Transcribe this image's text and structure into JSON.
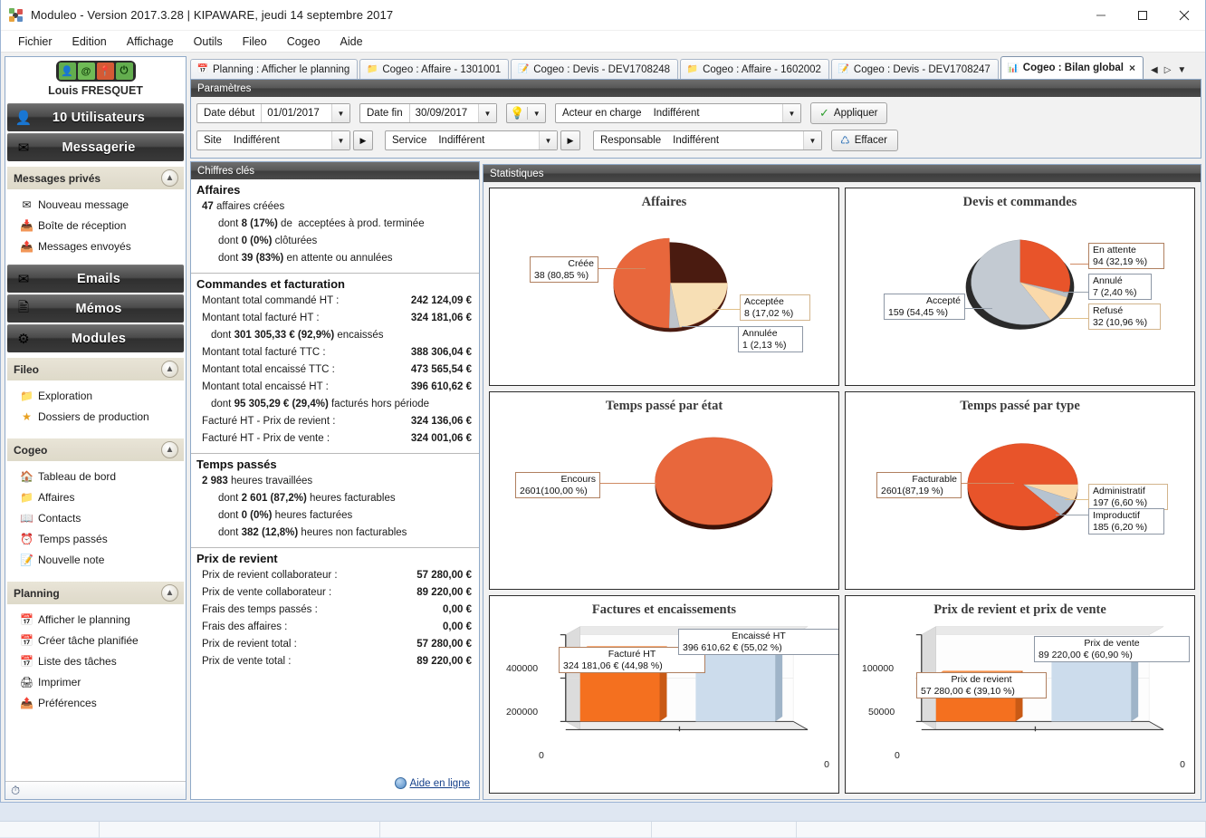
{
  "window": {
    "title": "Moduleo - Version 2017.3.28 | KIPAWARE, jeudi 14 septembre 2017",
    "minimize_label": "–",
    "maximize_label": "□",
    "close_label": "✕"
  },
  "menubar": {
    "items": [
      {
        "label": "Fichier"
      },
      {
        "label": "Edition"
      },
      {
        "label": "Affichage"
      },
      {
        "label": "Outils"
      },
      {
        "label": "Fileo"
      },
      {
        "label": "Cogeo"
      },
      {
        "label": "Aide"
      }
    ]
  },
  "sidebar": {
    "user_name": "Louis FRESQUET",
    "user_icons": [
      "contact-icon",
      "at-icon",
      "map-icon",
      "power-icon"
    ],
    "bands": [
      {
        "label": "10 Utilisateurs",
        "icon": "user-icon"
      },
      {
        "label": "Messagerie",
        "icon": "envelope-icon"
      },
      {
        "label": "Emails",
        "icon": "at-icon"
      },
      {
        "label": "Mémos",
        "icon": "note-icon"
      },
      {
        "label": "Modules",
        "icon": "modules-icon"
      }
    ],
    "groups": [
      {
        "title": "Messages privés",
        "items": [
          {
            "label": "Nouveau message",
            "icon": "new-message-icon"
          },
          {
            "label": "Boîte de réception",
            "icon": "inbox-icon"
          },
          {
            "label": "Messages envoyés",
            "icon": "sent-icon"
          }
        ]
      },
      {
        "title": "Fileo",
        "items": [
          {
            "label": "Exploration",
            "icon": "folder-search-icon"
          },
          {
            "label": "Dossiers de production",
            "icon": "star-icon"
          }
        ]
      },
      {
        "title": "Cogeo",
        "items": [
          {
            "label": "Tableau de bord",
            "icon": "home-icon"
          },
          {
            "label": "Affaires",
            "icon": "folder-icon"
          },
          {
            "label": "Contacts",
            "icon": "contacts-book-icon"
          },
          {
            "label": "Temps passés",
            "icon": "clock-icon"
          },
          {
            "label": "Nouvelle note",
            "icon": "new-note-icon"
          }
        ]
      },
      {
        "title": "Planning",
        "items": [
          {
            "label": "Afficher le planning",
            "icon": "calendar-icon"
          },
          {
            "label": "Créer tâche planifiée",
            "icon": "calendar-add-icon"
          },
          {
            "label": "Liste des tâches",
            "icon": "calendar-list-icon"
          },
          {
            "label": "Imprimer",
            "icon": "printer-icon"
          },
          {
            "label": "Préférences",
            "icon": "preferences-icon"
          }
        ]
      }
    ],
    "status_icon": "clock-icon"
  },
  "tabs": {
    "items": [
      {
        "label": "Planning : Afficher le planning",
        "icon": "calendar-icon",
        "active": false
      },
      {
        "label": "Cogeo : Affaire - 1301001",
        "icon": "folder-icon",
        "active": false
      },
      {
        "label": "Cogeo : Devis - DEV1708248",
        "icon": "quote-icon",
        "active": false
      },
      {
        "label": "Cogeo : Affaire - 1602002",
        "icon": "folder-icon",
        "active": false
      },
      {
        "label": "Cogeo : Devis - DEV1708247",
        "icon": "quote-icon",
        "active": false
      },
      {
        "label": "Cogeo : Bilan global",
        "icon": "chart-icon",
        "active": true
      }
    ],
    "close_label": "×",
    "nav_prev": "◀",
    "nav_next": "▷",
    "nav_menu": "▼"
  },
  "params": {
    "panel_title": "Paramètres",
    "date_debut_label": "Date début",
    "date_debut_value": "01/01/2017",
    "date_fin_label": "Date fin",
    "date_fin_value": "30/09/2017",
    "bulb_icon": "lightbulb-icon",
    "acteur_label": "Acteur en charge",
    "acteur_value": "Indifférent",
    "site_label": "Site",
    "site_value": "Indifférent",
    "service_label": "Service",
    "service_value": "Indifférent",
    "responsable_label": "Responsable",
    "responsable_value": "Indifférent",
    "apply_label": "Appliquer",
    "clear_label": "Effacer"
  },
  "keys": {
    "panel_title": "Chiffres clés",
    "sections": [
      {
        "title": "Affaires",
        "lines": [
          {
            "label": "47 affaires créées",
            "bold_prefix": "47",
            "rest": " affaires créées",
            "indent": 0
          },
          {
            "label": "dont 8 (17%) de acceptées à prod. terminée",
            "indent": 1
          },
          {
            "label": "dont 0 (0%) clôturées",
            "indent": 1
          },
          {
            "label": "dont 39 (83%) en attente ou annulées",
            "indent": 1
          }
        ]
      },
      {
        "title": "Commandes et facturation",
        "rows": [
          {
            "label": "Montant total commandé HT :",
            "value": "242 124,09 €"
          },
          {
            "label": "Montant total facturé HT :",
            "value": "324 181,06 €"
          },
          {
            "note": "dont 301 305,33 € (92,9%) encaissés"
          },
          {
            "label": "Montant total facturé TTC :",
            "value": "388 306,04 €"
          },
          {
            "label": "Montant total encaissé TTC :",
            "value": "473 565,54 €"
          },
          {
            "label": "Montant total encaissé HT :",
            "value": "396 610,62 €"
          },
          {
            "note": "dont 95 305,29 € (29,4%) facturés hors période"
          },
          {
            "label": "Facturé HT - Prix de revient :",
            "value": "324 136,06 €"
          },
          {
            "label": "Facturé HT - Prix de vente :",
            "value": "324 001,06 €"
          }
        ]
      },
      {
        "title": "Temps passés",
        "lines": [
          {
            "label": "2 983 heures travaillées",
            "indent": 0
          },
          {
            "label": "dont 2 601 (87,2%) heures facturables",
            "indent": 1
          },
          {
            "label": "dont 0 (0%) heures facturées",
            "indent": 1
          },
          {
            "label": "dont 382 (12,8%) heures non facturables",
            "indent": 1
          }
        ]
      },
      {
        "title": "Prix de revient",
        "rows": [
          {
            "label": "Prix de revient collaborateur :",
            "value": "57 280,00 €"
          },
          {
            "label": "Prix de vente collaborateur :",
            "value": "89 220,00 €"
          },
          {
            "label": "Frais des temps passés :",
            "value": "0,00 €"
          },
          {
            "label": "Frais des affaires :",
            "value": "0,00 €"
          },
          {
            "label": "Prix de revient total :",
            "value": "57 280,00 €"
          },
          {
            "label": "Prix de vente total :",
            "value": "89 220,00 €"
          }
        ]
      }
    ],
    "help_link": "Aide en ligne"
  },
  "stats": {
    "panel_title": "Statistiques"
  },
  "chart_data": [
    {
      "type": "pie",
      "title": "Affaires",
      "labels": [
        "Créée",
        "Acceptée",
        "Annulée"
      ],
      "values": [
        38,
        8,
        1
      ],
      "percents": [
        80.85,
        17.02,
        2.13
      ],
      "value_labels": [
        "38 (80,85 %)",
        "8 (17,02 %)",
        "1 (2,13 %)"
      ],
      "colors": [
        "#e8673c",
        "#f7dfb5",
        "#bfc4ca"
      ],
      "legend": "callouts"
    },
    {
      "type": "pie",
      "title": "Devis et commandes",
      "labels": [
        "En attente",
        "Annulé",
        "Refusé",
        "Accepté"
      ],
      "values": [
        94,
        7,
        32,
        159
      ],
      "percents": [
        32.19,
        2.4,
        10.96,
        54.45
      ],
      "value_labels": [
        "94 (32,19 %)",
        "7 (2,40 %)",
        "32 (10,96 %)",
        "159 (54,45 %)"
      ],
      "colors": [
        "#e8542a",
        "#b9bec4",
        "#fad9aa",
        "#c3cad2"
      ],
      "legend": "callouts"
    },
    {
      "type": "pie",
      "title": "Temps passé par état",
      "labels": [
        "Encours"
      ],
      "values": [
        2601
      ],
      "percents": [
        100.0
      ],
      "value_labels": [
        "2601(100,00 %)"
      ],
      "colors": [
        "#e8673c"
      ],
      "legend": "callouts"
    },
    {
      "type": "pie",
      "title": "Temps passé par type",
      "labels": [
        "Facturable",
        "Administratif",
        "Improductif"
      ],
      "values": [
        2601,
        197,
        185
      ],
      "percents": [
        87.19,
        6.6,
        6.2
      ],
      "value_labels": [
        "2601(87,19 %)",
        "197 (6,60 %)",
        "185 (6,20 %)"
      ],
      "colors": [
        "#e8542a",
        "#fad9aa",
        "#b6c3d0"
      ],
      "legend": "callouts"
    },
    {
      "type": "bar",
      "title": "Factures et encaissements",
      "categories": [
        "Facturé HT",
        "Encaissé HT"
      ],
      "values": [
        324181.06,
        396610.62
      ],
      "percents": [
        44.98,
        55.02
      ],
      "value_labels": [
        "324 181,06 € (44,98 %)",
        "396 610,62 € (55,02 %)"
      ],
      "colors": [
        "#f4701f",
        "#ccdcec"
      ],
      "yticks": [
        "400000",
        "200000",
        "0"
      ],
      "ylim": [
        0,
        440000
      ],
      "xaxis_right_label": "0",
      "xlabel": "",
      "ylabel": ""
    },
    {
      "type": "bar",
      "title": "Prix de revient et prix de vente",
      "categories": [
        "Prix de revient",
        "Prix de vente"
      ],
      "values": [
        57280.0,
        89220.0
      ],
      "percents": [
        39.1,
        60.9
      ],
      "value_labels": [
        "57 280,00 € (39,10 %)",
        "89 220,00 € (60,90 %)"
      ],
      "colors": [
        "#f4701f",
        "#ccdcec"
      ],
      "yticks": [
        "100000",
        "50000",
        "0"
      ],
      "ylim": [
        0,
        110000
      ],
      "xaxis_right_label": "0",
      "xlabel": "",
      "ylabel": ""
    }
  ]
}
